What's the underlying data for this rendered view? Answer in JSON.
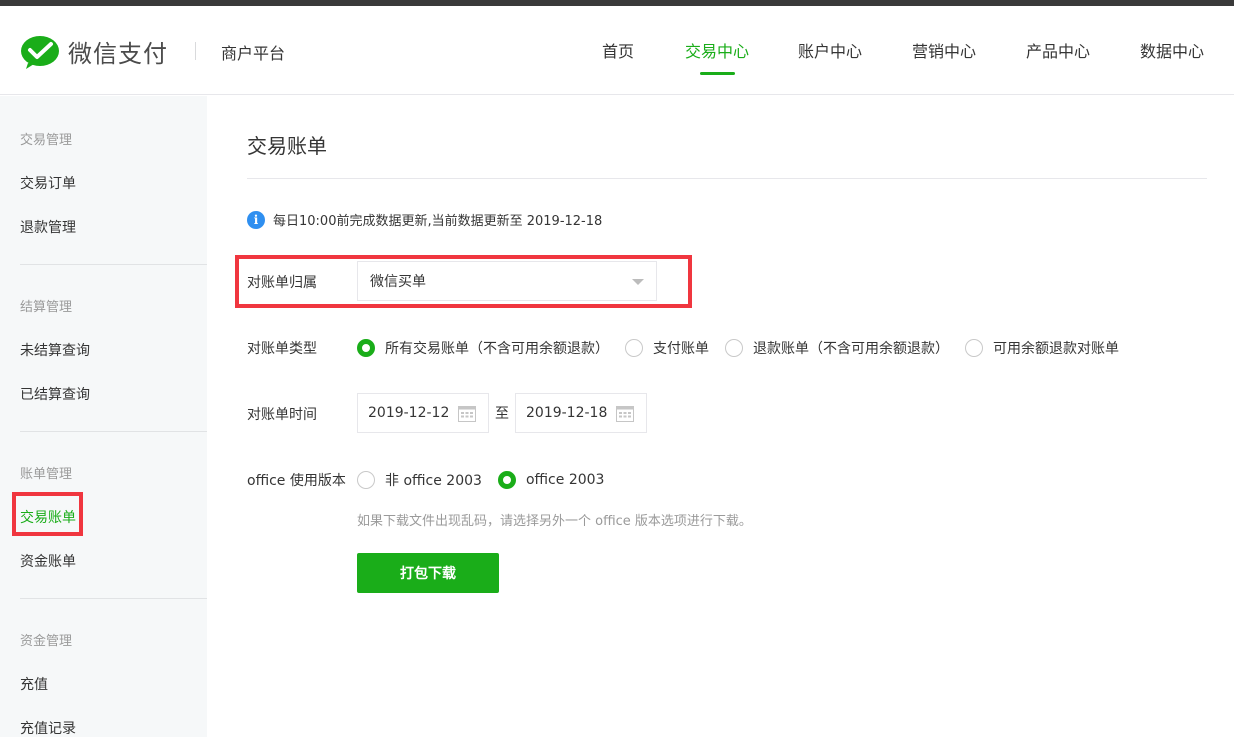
{
  "header": {
    "brand": "微信支付",
    "platform": "商户平台",
    "nav": [
      {
        "label": "首页",
        "active": false
      },
      {
        "label": "交易中心",
        "active": true
      },
      {
        "label": "账户中心",
        "active": false
      },
      {
        "label": "营销中心",
        "active": false
      },
      {
        "label": "产品中心",
        "active": false
      },
      {
        "label": "数据中心",
        "active": false
      }
    ]
  },
  "sidebar": {
    "groups": [
      {
        "title": "交易管理",
        "items": [
          "交易订单",
          "退款管理"
        ]
      },
      {
        "title": "结算管理",
        "items": [
          "未结算查询",
          "已结算查询"
        ]
      },
      {
        "title": "账单管理",
        "items": [
          "交易账单",
          "资金账单"
        ]
      },
      {
        "title": "资金管理",
        "items": [
          "充值",
          "充值记录"
        ]
      }
    ],
    "active_item": "交易账单"
  },
  "main": {
    "title": "交易账单",
    "notice": "每日10:00前完成数据更新,当前数据更新至 2019-12-18",
    "bill_owner": {
      "label": "对账单归属",
      "value": "微信买单"
    },
    "bill_type": {
      "label": "对账单类型",
      "options": [
        "所有交易账单（不含可用余额退款）",
        "支付账单",
        "退款账单（不含可用余额退款）",
        "可用余额退款对账单"
      ],
      "selected": 0
    },
    "bill_time": {
      "label": "对账单时间",
      "from": "2019-12-12",
      "to_text": "至",
      "to": "2019-12-18"
    },
    "office": {
      "label": "office 使用版本",
      "options": [
        "非 office 2003",
        "office 2003"
      ],
      "selected": 1
    },
    "hint": "如果下载文件出现乱码，请选择另外一个 office 版本选项进行下载。",
    "download_button": "打包下载"
  },
  "colors": {
    "accent": "#1aad19",
    "highlight": "#f0363f",
    "info": "#2f8ff0"
  }
}
